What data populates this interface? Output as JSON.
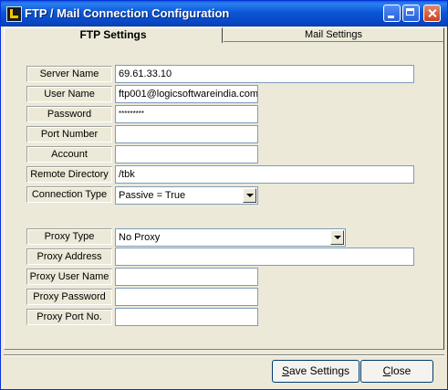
{
  "window": {
    "title": "FTP / Mail Connection Configuration"
  },
  "tabs": [
    {
      "label": "FTP Settings",
      "active": true
    },
    {
      "label": "Mail Settings",
      "active": false
    }
  ],
  "ftp": {
    "server_name": {
      "label": "Server Name",
      "value": "69.61.33.10"
    },
    "user_name": {
      "label": "User Name",
      "value": "ftp001@logicsoftwareindia.com"
    },
    "password": {
      "label": "Password",
      "value": "*********"
    },
    "port_number": {
      "label": "Port Number",
      "value": ""
    },
    "account": {
      "label": "Account",
      "value": ""
    },
    "remote_directory": {
      "label": "Remote Directory",
      "value": "/tbk"
    },
    "connection_type": {
      "label": "Connection Type",
      "value": "Passive = True"
    }
  },
  "proxy": {
    "proxy_type": {
      "label": "Proxy Type",
      "value": "No Proxy"
    },
    "proxy_address": {
      "label": "Proxy Address",
      "value": ""
    },
    "proxy_user_name": {
      "label": "Proxy User Name",
      "value": ""
    },
    "proxy_password": {
      "label": "Proxy Password",
      "value": ""
    },
    "proxy_port": {
      "label": "Proxy Port No.",
      "value": ""
    }
  },
  "buttons": {
    "save_first": "S",
    "save_rest": "ave Settings",
    "close_first": "C",
    "close_rest": "lose"
  }
}
